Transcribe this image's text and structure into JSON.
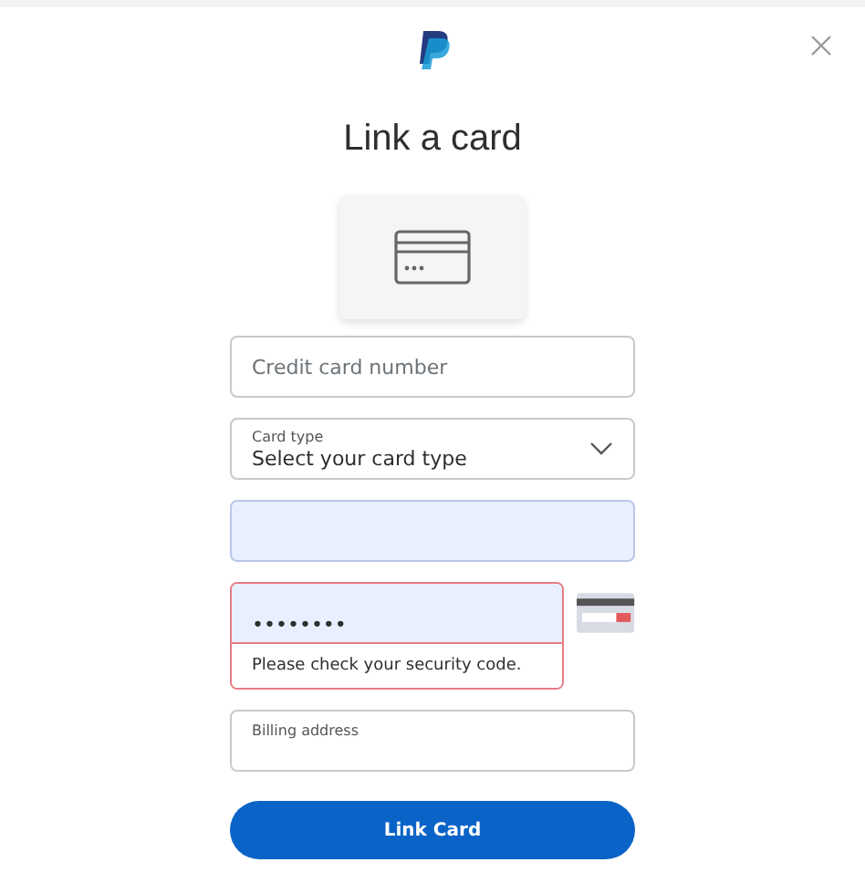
{
  "title": "Link a card",
  "fields": [
    {
      "kind": "text",
      "placeholder": "Credit card number"
    },
    {
      "kind": "select",
      "label": "Card type",
      "value": "Select your card type"
    },
    {
      "kind": "filled"
    },
    {
      "kind": "error",
      "value": "••••••••",
      "error": "Please check your security code."
    },
    {
      "kind": "labeled",
      "label": "Billing address"
    }
  ],
  "submit": "Link Card"
}
